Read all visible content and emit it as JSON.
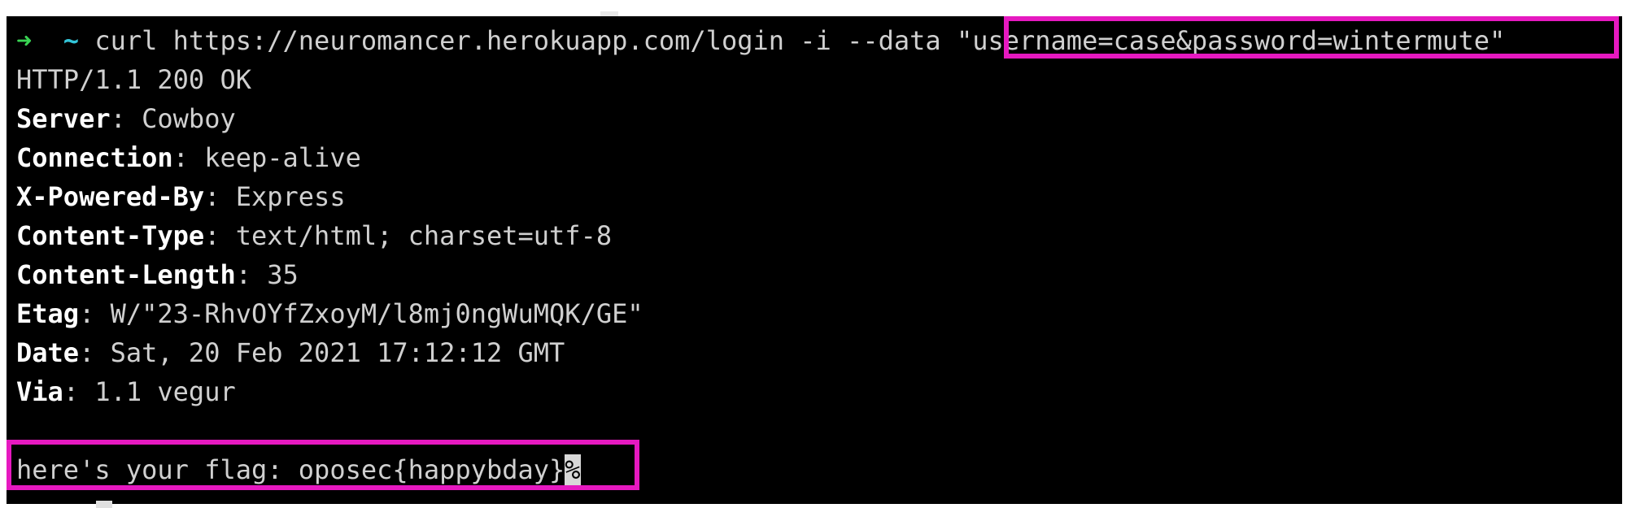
{
  "prompt": {
    "arrow": "➜",
    "dir": "~",
    "command": "curl https://neuromancer.herokuapp.com/login -i --data ",
    "data_arg": "\"username=case&password=wintermute\""
  },
  "response": {
    "status": "HTTP/1.1 200 OK",
    "headers": [
      {
        "name": "Server",
        "value": "Cowboy"
      },
      {
        "name": "Connection",
        "value": "keep-alive"
      },
      {
        "name": "X-Powered-By",
        "value": "Express"
      },
      {
        "name": "Content-Type",
        "value": "text/html; charset=utf-8"
      },
      {
        "name": "Content-Length",
        "value": "35"
      },
      {
        "name": "Etag",
        "value": "W/\"23-RhvOYfZxoyM/l8mj0ngWuMQK/GE\""
      },
      {
        "name": "Date",
        "value": "Sat, 20 Feb 2021 17:12:12 GMT"
      },
      {
        "name": "Via",
        "value": "1.1 vegur"
      }
    ],
    "body": "here's your flag: oposec{happybday}",
    "end_marker": "%"
  },
  "colors": {
    "highlight": "#e619c0",
    "prompt_arrow": "#39d353",
    "prompt_dir": "#33c5d8"
  }
}
